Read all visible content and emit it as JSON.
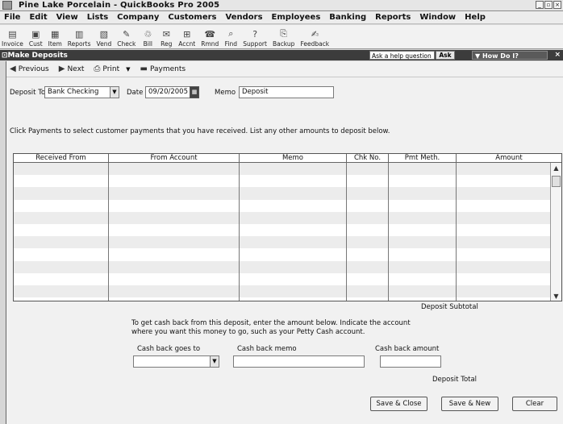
{
  "app": {
    "title": "Pine Lake Porcelain - QuickBooks Pro 2005"
  },
  "menu": [
    "File",
    "Edit",
    "View",
    "Lists",
    "Company",
    "Customers",
    "Vendors",
    "Employees",
    "Banking",
    "Reports",
    "Window",
    "Help"
  ],
  "toolbar": [
    {
      "label": "Invoice",
      "icon": "invoice-icon"
    },
    {
      "label": "Cust",
      "icon": "customer-icon"
    },
    {
      "label": "Item",
      "icon": "item-icon"
    },
    {
      "label": "Reports",
      "icon": "reports-icon"
    },
    {
      "label": "Vend",
      "icon": "vendor-icon"
    },
    {
      "label": "Check",
      "icon": "check-icon"
    },
    {
      "label": "Bill",
      "icon": "bill-icon"
    },
    {
      "label": "Reg",
      "icon": "register-icon"
    },
    {
      "label": "Accnt",
      "icon": "account-icon"
    },
    {
      "label": "Rmnd",
      "icon": "reminder-icon"
    },
    {
      "label": "Find",
      "icon": "find-icon"
    },
    {
      "label": "Support",
      "icon": "support-icon"
    },
    {
      "label": "Backup",
      "icon": "backup-icon"
    },
    {
      "label": "Feedback",
      "icon": "feedback-icon"
    }
  ],
  "subbar": {
    "window_title": "Make Deposits",
    "help_placeholder": "Ask a help question",
    "ask_label": "Ask",
    "how_do_i": "How Do I?"
  },
  "window_toolbar": {
    "previous": "Previous",
    "next": "Next",
    "print": "Print",
    "payments": "Payments"
  },
  "form": {
    "deposit_to_label": "Deposit To",
    "deposit_to_value": "Bank Checking",
    "date_label": "Date",
    "date_value": "09/20/2005",
    "memo_label": "Memo",
    "memo_value": "Deposit",
    "instructions": "Click Payments to select customer payments that you have received. List any other amounts to deposit below."
  },
  "grid": {
    "columns": [
      "Received From",
      "From Account",
      "Memo",
      "Chk No.",
      "Pmt Meth.",
      "Amount"
    ]
  },
  "summary": {
    "subtotal_label": "Deposit Subtotal",
    "cashback_text_1": "To get cash back from this deposit, enter the amount below.  Indicate the account",
    "cashback_text_2": "where you want this money to go, such as your Petty Cash account.",
    "cashback_goes_to": "Cash back goes to",
    "cashback_memo": "Cash back memo",
    "cashback_amount": "Cash back amount",
    "total_label": "Deposit Total"
  },
  "buttons": {
    "save_close": "Save & Close",
    "save_new": "Save & New",
    "clear": "Clear"
  }
}
